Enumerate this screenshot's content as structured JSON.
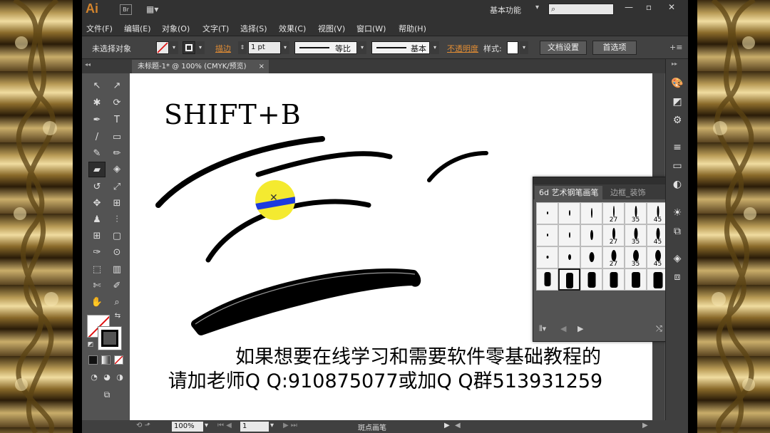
{
  "app": {
    "logo": "Ai",
    "bridge": "Br",
    "layout_icon": "▦▾",
    "workspace": "基本功能",
    "workspace_arrow": "▾",
    "search_placeholder": "",
    "window_buttons": [
      "—",
      "▫",
      "✕"
    ]
  },
  "menu": [
    "文件(F)",
    "编辑(E)",
    "对象(O)",
    "文字(T)",
    "选择(S)",
    "效果(C)",
    "视图(V)",
    "窗口(W)",
    "帮助(H)"
  ],
  "control": {
    "selection": "未选择对象",
    "stroke_label": "描边",
    "stroke_weight": "1 pt",
    "profile": "等比",
    "brush": "基本",
    "opacity_label": "不透明度",
    "style_label": "样式:",
    "doc_setup": "文档设置",
    "preferences": "首选项",
    "panel_menu": "+≡"
  },
  "document": {
    "tab": "未标题-1* @ 100% (CMYK/预览)",
    "close": "×"
  },
  "artboard": {
    "shortcut": "SHIFT+B",
    "caption_line1": "如果想要在线学习和需要软件零基础教程的",
    "caption_line2": "请加老师Q  Q:910875077或加Q  Q群513931259",
    "cursor_mark": "✕",
    "colors": {
      "highlight": "#f4ea30",
      "stroke_blue": "#1c3adf"
    }
  },
  "brush_panel": {
    "top_controls": "◂◂ ✕",
    "tab_active": "6d 艺术钢笔画笔",
    "tab_inactive": "边框_装饰",
    "menu": "▾≡",
    "rows": [
      [
        "",
        "",
        "",
        "27",
        "35",
        "45"
      ],
      [
        "",
        "",
        "",
        "27",
        "35",
        "45"
      ],
      [
        "",
        "",
        "",
        "27",
        "35",
        "45"
      ],
      [
        "",
        "",
        "",
        "",
        "",
        ""
      ]
    ],
    "bottom_icons": [
      "⫴▾",
      "◀",
      "▶",
      "⤭"
    ]
  },
  "status": {
    "zoom": "100%",
    "page": "1",
    "tool": "斑点画笔",
    "arrows": [
      "◀",
      "▶"
    ]
  },
  "tools": [
    "↖",
    "↗",
    "✱",
    "⟳",
    "✒",
    "T",
    "/",
    "▭",
    "✎",
    "✏",
    "▰",
    "◈",
    "↺",
    "⤢",
    "✥",
    "⊞",
    "♟",
    "⫶",
    "⊞",
    "▢",
    "✑",
    "⊙",
    "⬚",
    "▥",
    "✄",
    "✐",
    "✋",
    "⌕"
  ],
  "dock_icons": [
    "🎨",
    "◩",
    "⚙",
    "≡",
    "▭",
    "◐",
    "☀",
    "⧉",
    "◈",
    "⧈"
  ]
}
